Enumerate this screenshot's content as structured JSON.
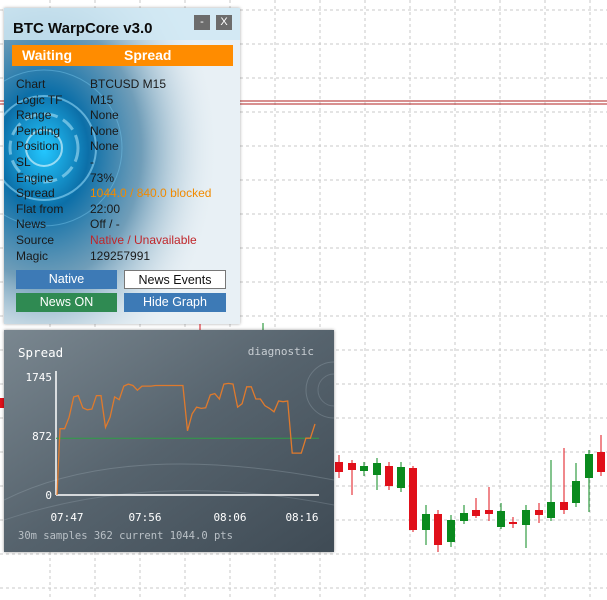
{
  "panel": {
    "title": "BTC WarpCore v3.0",
    "minimize_label": "-",
    "close_label": "X",
    "status_left": "Waiting",
    "status_right": "Spread",
    "rows": [
      {
        "key": "Chart",
        "value": "BTCUSD M15",
        "color": "#1a1a1a"
      },
      {
        "key": "Logic TF",
        "value": "M15",
        "color": "#1a1a1a"
      },
      {
        "key": "Range",
        "value": "None",
        "color": "#1a1a1a"
      },
      {
        "key": "Pending",
        "value": "None",
        "color": "#1a1a1a"
      },
      {
        "key": "Position",
        "value": "None",
        "color": "#1a1a1a"
      },
      {
        "key": "SL",
        "value": "-",
        "color": "#1a1a1a"
      },
      {
        "key": "Engine",
        "value": "73%",
        "color": "#1a1a1a"
      },
      {
        "key": "Spread",
        "value": "1044.0 / 840.0 blocked",
        "color": "#f08a00"
      },
      {
        "key": "Flat from",
        "value": "22:00",
        "color": "#1a1a1a"
      },
      {
        "key": "News",
        "value": "Off / -",
        "color": "#1a1a1a"
      },
      {
        "key": "Source",
        "value": "Native / Unavailable",
        "color": "#c0262a"
      },
      {
        "key": "Magic",
        "value": "129257991",
        "color": "#1a1a1a"
      }
    ],
    "buttons": {
      "native": "Native",
      "news_events": "News Events",
      "news_on": "News ON",
      "hide_graph": "Hide Graph"
    }
  },
  "graph": {
    "title": "Spread",
    "tag": "diagnostic",
    "footer": "30m samples 362   current 1044.0 pts"
  },
  "chart_data": {
    "type": "line",
    "title": "Spread",
    "y_ticks": [
      {
        "label": "1745",
        "value": 1745
      },
      {
        "label": "872",
        "value": 872
      },
      {
        "label": "0",
        "value": 0
      }
    ],
    "x_ticks": [
      "07:47",
      "07:56",
      "08:06",
      "08:16"
    ],
    "ylim": [
      0,
      1745
    ],
    "reference_line": 840,
    "series": [
      {
        "color": "#e07a2c",
        "values": [
          980,
          980,
          1150,
          1450,
          1470,
          1290,
          1260,
          1270,
          1470,
          1470,
          1000,
          1150,
          1450,
          1410,
          1610,
          1640,
          1620,
          1550,
          1610,
          1610,
          1610,
          1620,
          1620,
          1620,
          1620,
          1620,
          1620,
          1620,
          950,
          1200,
          1300,
          1280,
          1290,
          1480,
          1500,
          1420,
          1640,
          1650,
          1640,
          1300,
          1350,
          1600,
          1600,
          1420,
          1420,
          1320,
          1280,
          1230,
          1390,
          1380,
          1390,
          620,
          620,
          620,
          840,
          840,
          1050
        ]
      }
    ]
  }
}
